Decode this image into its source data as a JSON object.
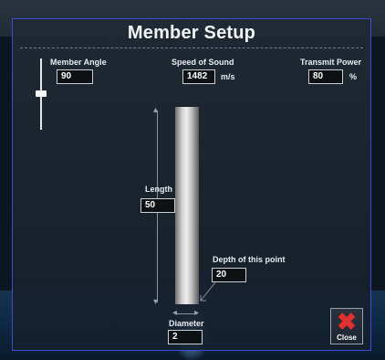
{
  "window": {
    "title": "Member Setup"
  },
  "member_angle": {
    "label": "Member Angle",
    "value": "90"
  },
  "speed_of_sound": {
    "label": "Speed of Sound",
    "value": "1482",
    "unit": "m/s"
  },
  "transmit_power": {
    "label": "Transmit Power",
    "value": "80",
    "unit": "%"
  },
  "length": {
    "label": "Length",
    "value": "50"
  },
  "depth": {
    "label": "Depth of this point",
    "value": "20"
  },
  "diameter": {
    "label": "Diameter",
    "value": "2"
  },
  "close_button": {
    "label": "Close",
    "icon": "close-x-icon",
    "color": "#e03131"
  },
  "icons": {
    "length_dimension": "vertical-dimension-arrow-icon",
    "diameter_dimension": "horizontal-double-arrow-icon",
    "depth_pointer": "diagonal-pointer-icon"
  },
  "colors": {
    "dialog_border": "#3d4bd6",
    "dialog_background": "#1e2933"
  }
}
